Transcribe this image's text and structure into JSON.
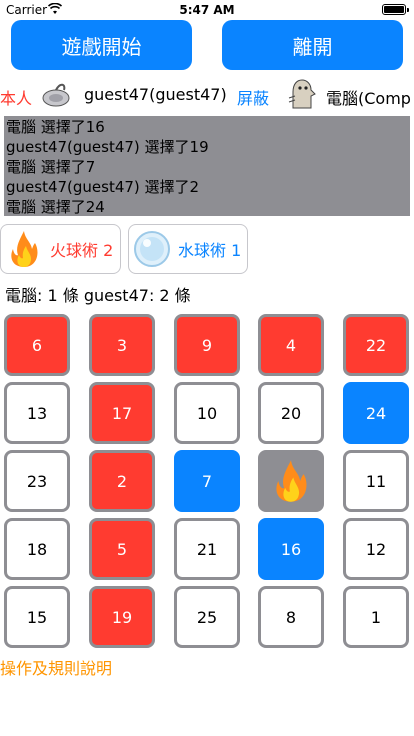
{
  "status_bar": {
    "carrier": "Carrier",
    "time": "5:47 AM"
  },
  "buttons": {
    "start": "遊戲開始",
    "leave": "離開"
  },
  "players": {
    "self_label": "本人",
    "self_name": "guest47(guest47)",
    "block_label": "屏蔽",
    "opponent_name": "電腦(Comp"
  },
  "log": [
    "電腦 選擇了16",
    "guest47(guest47) 選擇了19",
    "電腦 選擇了7",
    "guest47(guest47) 選擇了2",
    "電腦 選擇了24"
  ],
  "skills": {
    "fire": {
      "label": "火球術 2",
      "icon": "fireball-icon"
    },
    "water": {
      "label": "水球術 1",
      "icon": "waterball-icon"
    }
  },
  "score": "電腦: 1 條 guest47: 2 條",
  "board": [
    [
      {
        "value": "6",
        "state": "red"
      },
      {
        "value": "3",
        "state": "red"
      },
      {
        "value": "9",
        "state": "red"
      },
      {
        "value": "4",
        "state": "red"
      },
      {
        "value": "22",
        "state": "red"
      }
    ],
    [
      {
        "value": "13",
        "state": "white"
      },
      {
        "value": "17",
        "state": "red"
      },
      {
        "value": "10",
        "state": "white"
      },
      {
        "value": "20",
        "state": "white"
      },
      {
        "value": "24",
        "state": "blue"
      }
    ],
    [
      {
        "value": "23",
        "state": "white"
      },
      {
        "value": "2",
        "state": "red"
      },
      {
        "value": "7",
        "state": "blue"
      },
      {
        "value": "",
        "state": "fire"
      },
      {
        "value": "11",
        "state": "white"
      }
    ],
    [
      {
        "value": "18",
        "state": "white"
      },
      {
        "value": "5",
        "state": "red"
      },
      {
        "value": "21",
        "state": "white"
      },
      {
        "value": "16",
        "state": "blue"
      },
      {
        "value": "12",
        "state": "white"
      }
    ],
    [
      {
        "value": "15",
        "state": "white"
      },
      {
        "value": "19",
        "state": "red"
      },
      {
        "value": "25",
        "state": "white"
      },
      {
        "value": "8",
        "state": "white"
      },
      {
        "value": "1",
        "state": "white"
      }
    ]
  ],
  "help_link": "操作及規則說明",
  "colors": {
    "accent_blue": "#0a84ff",
    "red": "#ff3b30",
    "gray": "#8e8e93",
    "help_orange": "#ff9500"
  }
}
